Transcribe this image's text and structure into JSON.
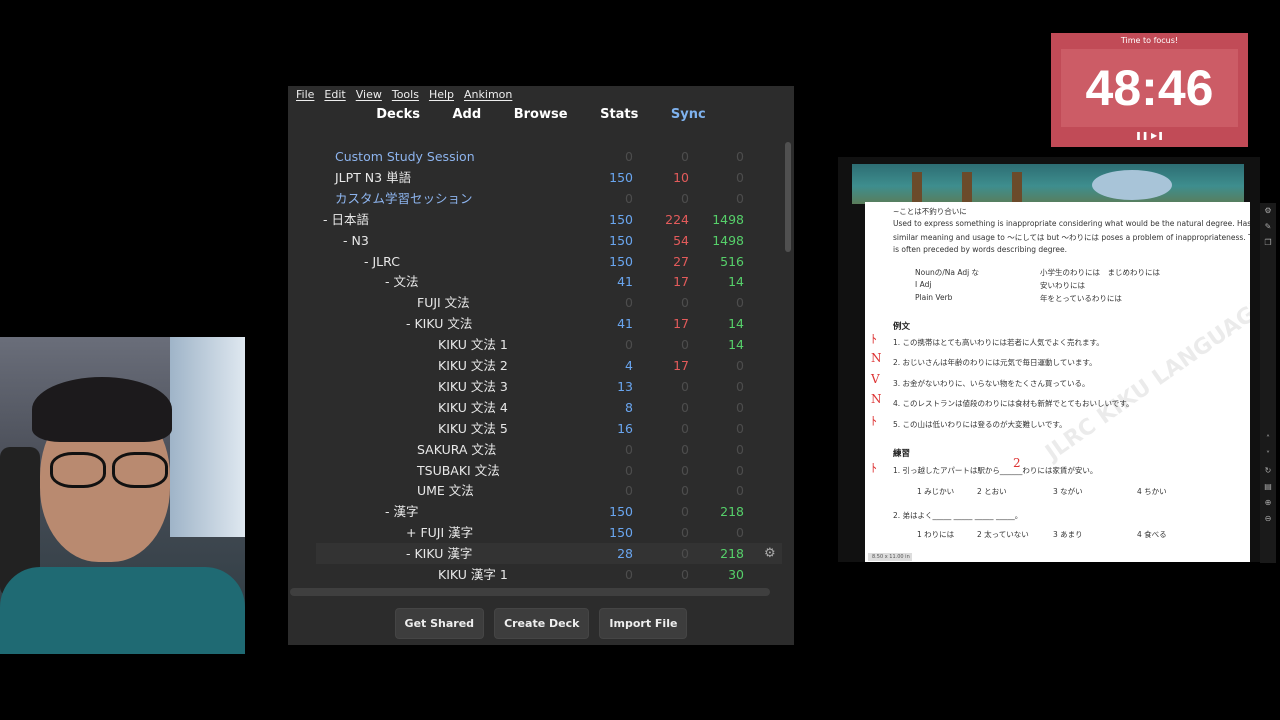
{
  "menu": [
    "File",
    "Edit",
    "View",
    "Tools",
    "Help",
    "Ankimon"
  ],
  "toolbar": {
    "decks": "Decks",
    "add": "Add",
    "browse": "Browse",
    "stats": "Stats",
    "sync": "Sync"
  },
  "decks": [
    {
      "name": "Custom Study Session",
      "new": "0",
      "learn": "0",
      "due": "0",
      "blue": true
    },
    {
      "name": "JLPT N3 単語",
      "new": "150",
      "learn": "10",
      "due": "0"
    },
    {
      "name": "カスタム学習セッション",
      "new": "0",
      "learn": "0",
      "due": "0",
      "blue": true
    },
    {
      "name": "- 日本語",
      "new": "150",
      "learn": "224",
      "due": "1498"
    },
    {
      "name": "- N3",
      "new": "150",
      "learn": "54",
      "due": "1498"
    },
    {
      "name": "- JLRC",
      "new": "150",
      "learn": "27",
      "due": "516"
    },
    {
      "name": "- 文法",
      "new": "41",
      "learn": "17",
      "due": "14"
    },
    {
      "name": "FUJI 文法",
      "new": "0",
      "learn": "0",
      "due": "0"
    },
    {
      "name": "- KIKU 文法",
      "new": "41",
      "learn": "17",
      "due": "14"
    },
    {
      "name": "KIKU 文法 1",
      "new": "0",
      "learn": "0",
      "due": "14"
    },
    {
      "name": "KIKU 文法 2",
      "new": "4",
      "learn": "17",
      "due": "0"
    },
    {
      "name": "KIKU 文法 3",
      "new": "13",
      "learn": "0",
      "due": "0"
    },
    {
      "name": "KIKU 文法 4",
      "new": "8",
      "learn": "0",
      "due": "0"
    },
    {
      "name": "KIKU 文法 5",
      "new": "16",
      "learn": "0",
      "due": "0"
    },
    {
      "name": "SAKURA 文法",
      "new": "0",
      "learn": "0",
      "due": "0"
    },
    {
      "name": "TSUBAKI 文法",
      "new": "0",
      "learn": "0",
      "due": "0"
    },
    {
      "name": "UME 文法",
      "new": "0",
      "learn": "0",
      "due": "0"
    },
    {
      "name": "- 漢字",
      "new": "150",
      "learn": "0",
      "due": "218"
    },
    {
      "name": "+ FUJI 漢字",
      "new": "150",
      "learn": "0",
      "due": "0"
    },
    {
      "name": "- KIKU 漢字",
      "new": "28",
      "learn": "0",
      "due": "218"
    },
    {
      "name": "KIKU 漢字 1",
      "new": "0",
      "learn": "0",
      "due": "30"
    }
  ],
  "buttons": {
    "get_shared": "Get Shared",
    "create_deck": "Create Deck",
    "import_file": "Import File"
  },
  "timer": {
    "label": "Time to focus!",
    "time": "48:46",
    "controls": "❚❚ ▶❚"
  },
  "document": {
    "title_line": "~ことは不釣り合いに",
    "desc1": "Used to express something is inappropriate considering what would be the natural degree. Has",
    "desc2": "similar meaning and usage to ～にしては but ～わりには poses a problem of inappropriateness. This",
    "desc3": "is often preceded by words describing degree.",
    "pattern_rows": [
      {
        "left": "Nounの/Na Adj な",
        "right": "小学生のわりには　まじめわりには"
      },
      {
        "left": "I Adj",
        "right": "安いわりには"
      },
      {
        "left": "Plain Verb",
        "right": "年をとっているわりには"
      }
    ],
    "examples_heading": "例文",
    "examples": [
      "1. この携帯はとても高いわりには若者に人気でよく売れます。",
      "2. おじいさんは年齢のわりには元気で毎日運動しています。",
      "3. お金がないわりに、いらない物をたくさん買っている。",
      "4. このレストランは値段のわりには食材も新鮮でとてもおいしいです。",
      "5. この山は低いわりには登るのが大変難しいです。"
    ],
    "practice_heading": "練習",
    "q1": "1. 引っ越したアパートは駅から______わりには家賃が安い。",
    "q1_choices": [
      "1 みじかい",
      "2 とおい",
      "3 ながい",
      "4 ちかい"
    ],
    "q1_answer": "2",
    "q2": "2. 弟はよく_____ _____ _____ _____。",
    "q2_choices": [
      "1 わりには",
      "2 太っていない",
      "3 あまり",
      "4 食べる"
    ],
    "watermark": "JLRC KIKU LANGUAGE CENTER",
    "zoom": "8.50 x 11.00 in"
  }
}
